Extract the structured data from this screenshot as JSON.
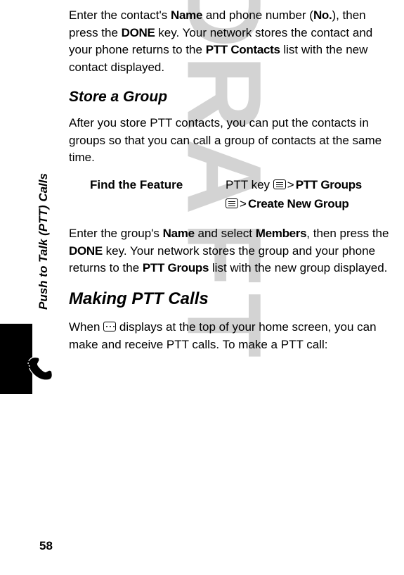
{
  "watermark": "DRAFT",
  "sideLabel": "Push to Talk (PTT) Calls",
  "pageNumber": "58",
  "p1": {
    "t1": "Enter the contact's ",
    "name": "Name",
    "t2": " and phone number (",
    "no": "No.",
    "t3": "), then press the ",
    "done": "DONE",
    "t4": " key. Your network stores the contact and your phone returns to the ",
    "pttc": "PTT Contacts",
    "t5": " list with the new contact displayed."
  },
  "h2": "Store a Group",
  "p2": "After you store PTT contacts, you can put the contacts in groups so that you can call a group of contacts at the same time.",
  "feature": {
    "label": "Find the Feature",
    "r1a": "PTT key ",
    "gt": ">",
    "r1b": "PTT Groups",
    "r2b": "Create New Group"
  },
  "p3": {
    "t1": "Enter the group's ",
    "name": "Name",
    "t2": " and select ",
    "members": "Members",
    "t3": ", then press the ",
    "done": "DONE",
    "t4": " key. Your network stores the group and your phone returns to the ",
    "pttg": "PTT Groups",
    "t5": " list with the new group displayed."
  },
  "h1": "Making PTT Calls",
  "p4": {
    "t1": "When ",
    "t2": " displays at the top of your home screen, you can make and receive PTT calls. To make a PTT call:"
  }
}
